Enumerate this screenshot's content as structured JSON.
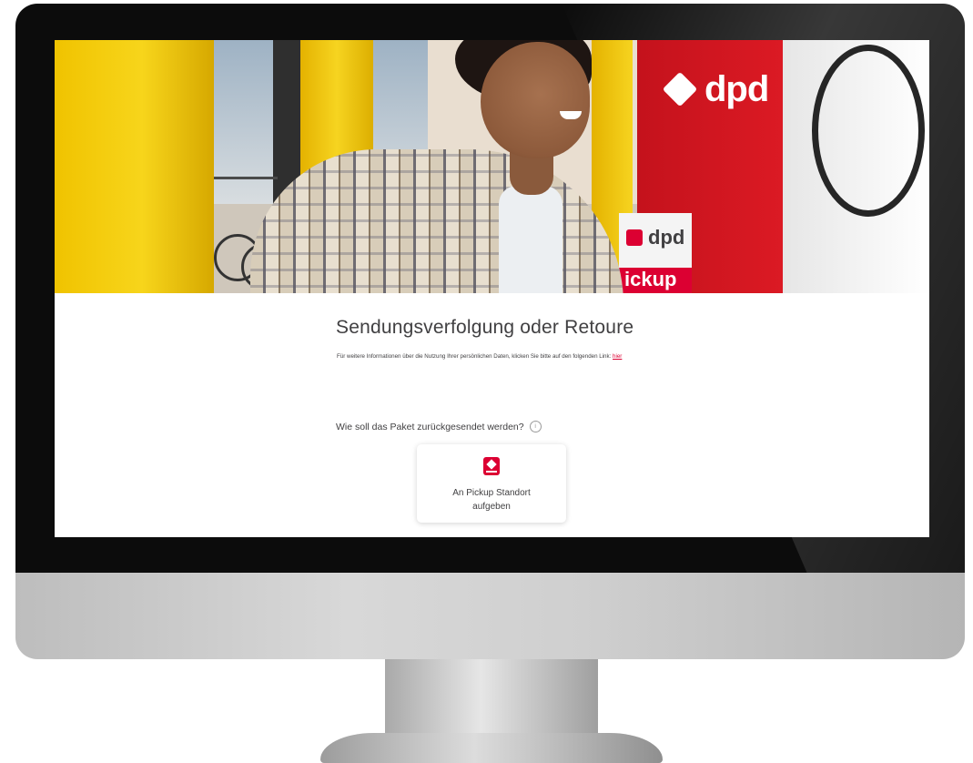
{
  "hero": {
    "van_logo_text": "dpd",
    "sign_logo_text": "dpd",
    "sign_pickup_text": "ickup"
  },
  "page": {
    "title": "Sendungsverfolgung oder Retoure",
    "privacy_text": "Für weitere Informationen über die Nutzung Ihrer persönlichen Daten, klicken Sie bitte auf den folgenden Link:",
    "privacy_link": "hier",
    "question": "Wie soll das Paket zurückgesendet werden?",
    "info_icon": "i",
    "option": {
      "line1": "An Pickup Standort",
      "line2": "aufgeben"
    }
  },
  "colors": {
    "brand_red": "#dc0032",
    "text": "#414042"
  },
  "icons": [
    "info-icon",
    "pickup-shop-icon",
    "dpd-logo-icon"
  ]
}
